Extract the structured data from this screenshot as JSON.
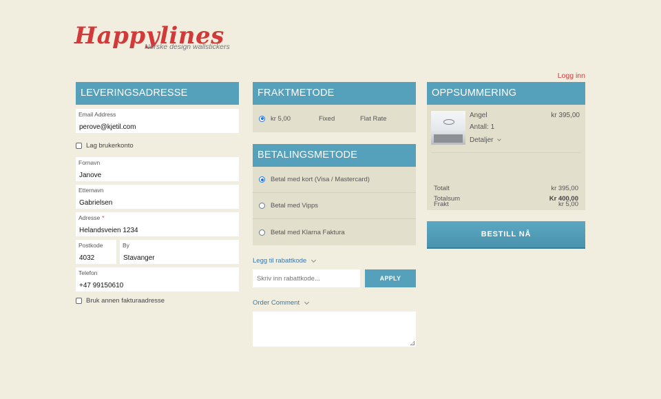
{
  "brand": {
    "name": "Happylines",
    "tagline": "Norske design wallstickers"
  },
  "header": {
    "login_label": "Logg inn"
  },
  "delivery": {
    "title": "LEVERINGSADRESSE",
    "email": {
      "label": "Email Address",
      "value": "perove@kjetil.com"
    },
    "create_account_label": "Lag brukerkonto",
    "first_name": {
      "label": "Fornavn",
      "value": "Janove"
    },
    "last_name": {
      "label": "Etternavn",
      "value": "Gabrielsen"
    },
    "address": {
      "label": "Adresse",
      "required_mark": "*",
      "value": "Helandsveien 1234"
    },
    "postcode": {
      "label": "Postkode",
      "value": "4032"
    },
    "city": {
      "label": "By",
      "value": "Stavanger"
    },
    "phone": {
      "label": "Telefon",
      "value": "+47 99150610"
    },
    "other_billing_label": "Bruk annen fakturaadresse"
  },
  "shipping": {
    "title": "FRAKTMETODE",
    "option": {
      "price": "kr 5,00",
      "type": "Fixed",
      "name": "Flat Rate"
    }
  },
  "payment": {
    "title": "BETALINGSMETODE",
    "options": [
      {
        "label": "Betal med kort (Visa / Mastercard)",
        "selected": true
      },
      {
        "label": "Betal med Vipps",
        "selected": false
      },
      {
        "label": "Betal med Klarna Faktura",
        "selected": false
      }
    ]
  },
  "coupon": {
    "toggle_label": "Legg til rabattkode",
    "placeholder": "Skriv inn rabattkode...",
    "apply_label": "APPLY"
  },
  "comment": {
    "toggle_label": "Order Comment"
  },
  "summary": {
    "title": "OPPSUMMERING",
    "item": {
      "name": "Angel",
      "price": "kr 395,00",
      "qty": "Antall: 1",
      "details_label": "Detaljer"
    },
    "subtotal": {
      "label": "Totalt",
      "value": "kr 395,00"
    },
    "shipping": {
      "label": "Frakt",
      "value": "kr 5,00"
    },
    "total": {
      "label": "Totalsum",
      "value": "Kr 400,00"
    }
  },
  "order_button_label": "BESTILL NÅ",
  "colors": {
    "background": "#f1eedf",
    "header_blue": "#55a0bb",
    "panel": "#e3dfcd",
    "brand_red": "#d23a3a",
    "link_blue": "#3a77a8"
  }
}
